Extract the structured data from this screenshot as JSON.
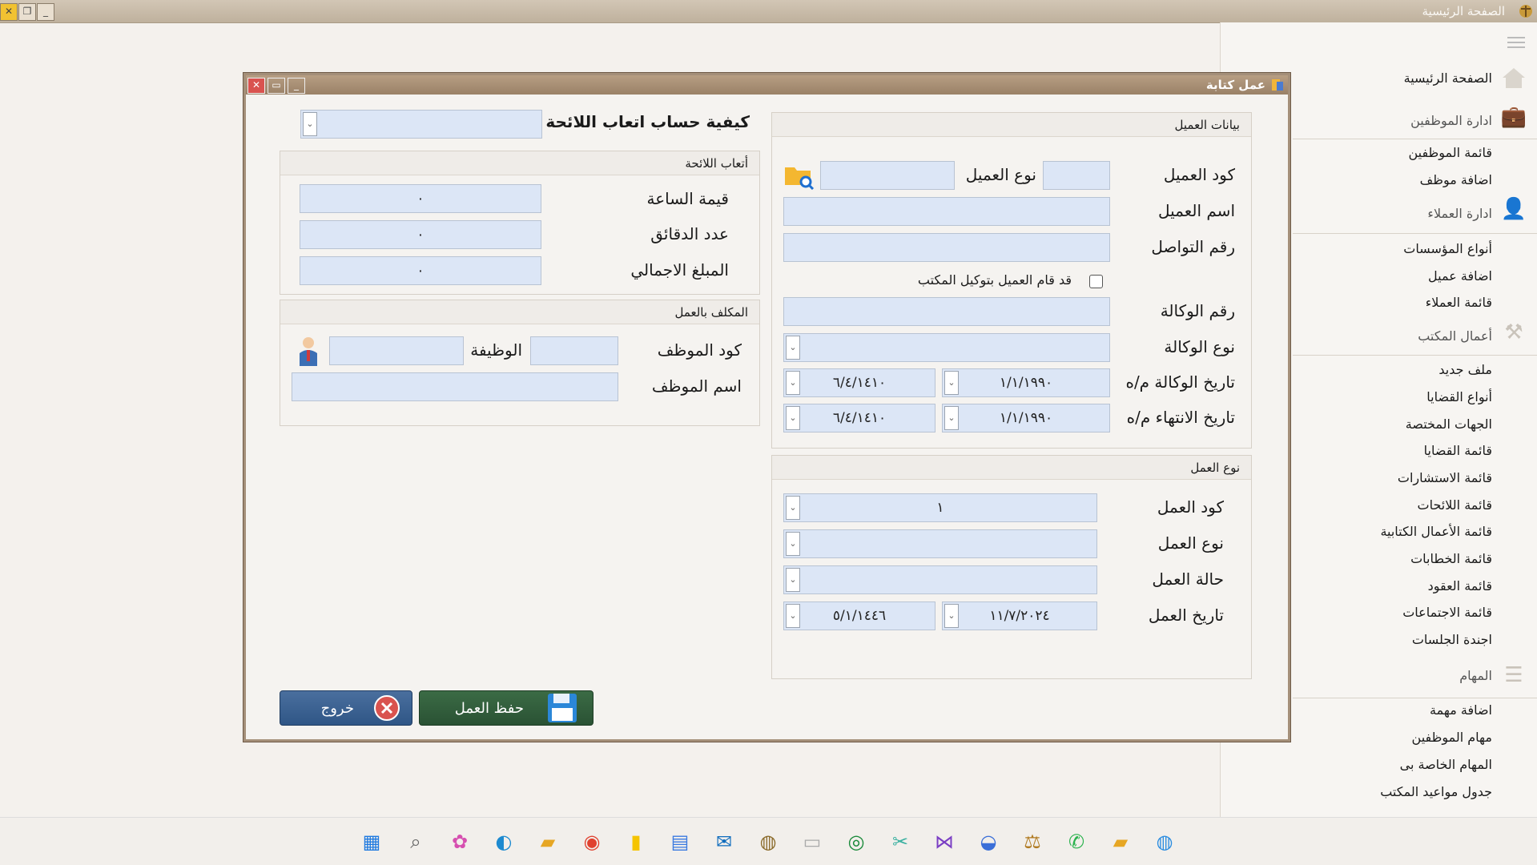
{
  "main_window": {
    "title": "الصفحة الرئيسية"
  },
  "sidebar": {
    "home": "الصفحة الرئيسية",
    "sections": [
      {
        "header": "ادارة الموظفين",
        "icon": "briefcase-icon",
        "items": [
          "قائمة الموظفين",
          "اضافة موظف"
        ]
      },
      {
        "header": "ادارة العملاء",
        "icon": "user-icon",
        "items": [
          "أنواع المؤسسات",
          "اضافة عميل",
          "قائمة العملاء"
        ]
      },
      {
        "header": "أعمال المكتب",
        "icon": "gavel-icon",
        "items": [
          "ملف جديد",
          "أنواع القضايا",
          "الجهات المختصة",
          "قائمة القضايا",
          "قائمة الاستشارات",
          "قائمة اللائحات",
          "قائمة الأعمال الكتابية",
          "قائمة الخطابات",
          "قائمة العقود",
          "قائمة الاجتماعات",
          "اجندة الجلسات"
        ]
      },
      {
        "header": "المهام",
        "icon": "list-icon",
        "items": [
          "اضافة مهمة",
          "مهام الموظفين",
          "المهام الخاصة بى",
          "جدول مواعيد المكتب"
        ]
      }
    ]
  },
  "dialog": {
    "title": "عمل كتابة",
    "fee_calc_label": "كيفية حساب اتعاب اللائحة",
    "fee_calc_value": "",
    "fees_group": {
      "title": "أتعاب اللائحة",
      "hour_value_label": "قيمة الساعة",
      "hour_value": "٠",
      "minutes_label": "عدد الدقائق",
      "minutes": "٠",
      "total_label": "المبلغ الاجمالي",
      "total": "٠"
    },
    "assignee_group": {
      "title": "المكلف بالعمل",
      "emp_code_label": "كود الموظف",
      "emp_code": "",
      "job_label": "الوظيفة",
      "job": "",
      "emp_name_label": "اسم الموظف",
      "emp_name": ""
    },
    "client_group": {
      "title": "بيانات العميل",
      "client_code_label": "كود العميل",
      "client_code": "",
      "client_type_label": "نوع العميل",
      "client_type": "",
      "client_name_label": "اسم العميل",
      "client_name": "",
      "contact_label": "رقم التواصل",
      "contact": "",
      "agency_checkbox_label": "قد قام العميل بتوكيل المكتب",
      "agency_checked": false,
      "agency_no_label": "رقم الوكالة",
      "agency_no": "",
      "agency_type_label": "نوع الوكالة",
      "agency_type": "",
      "agency_date_label": "تاريخ الوكالة م/ه",
      "agency_date_g": "١/١/١٩٩٠",
      "agency_date_h": "٦/٤/١٤١٠",
      "expiry_date_label": "تاريخ الانتهاء  م/ه",
      "expiry_date_g": "١/١/١٩٩٠",
      "expiry_date_h": "٦/٤/١٤١٠"
    },
    "work_group": {
      "title": "نوع العمل",
      "work_code_label": "كود العمل",
      "work_code": "١",
      "work_type_label": "نوع العمل",
      "work_type": "",
      "work_status_label": "حالة العمل",
      "work_status": "",
      "work_date_label": "تاريخ العمل",
      "work_date_g": "١١/٧/٢٠٢٤",
      "work_date_h": "٥/١/١٤٤٦"
    },
    "save_button": "حفظ العمل",
    "exit_button": "خروج"
  }
}
